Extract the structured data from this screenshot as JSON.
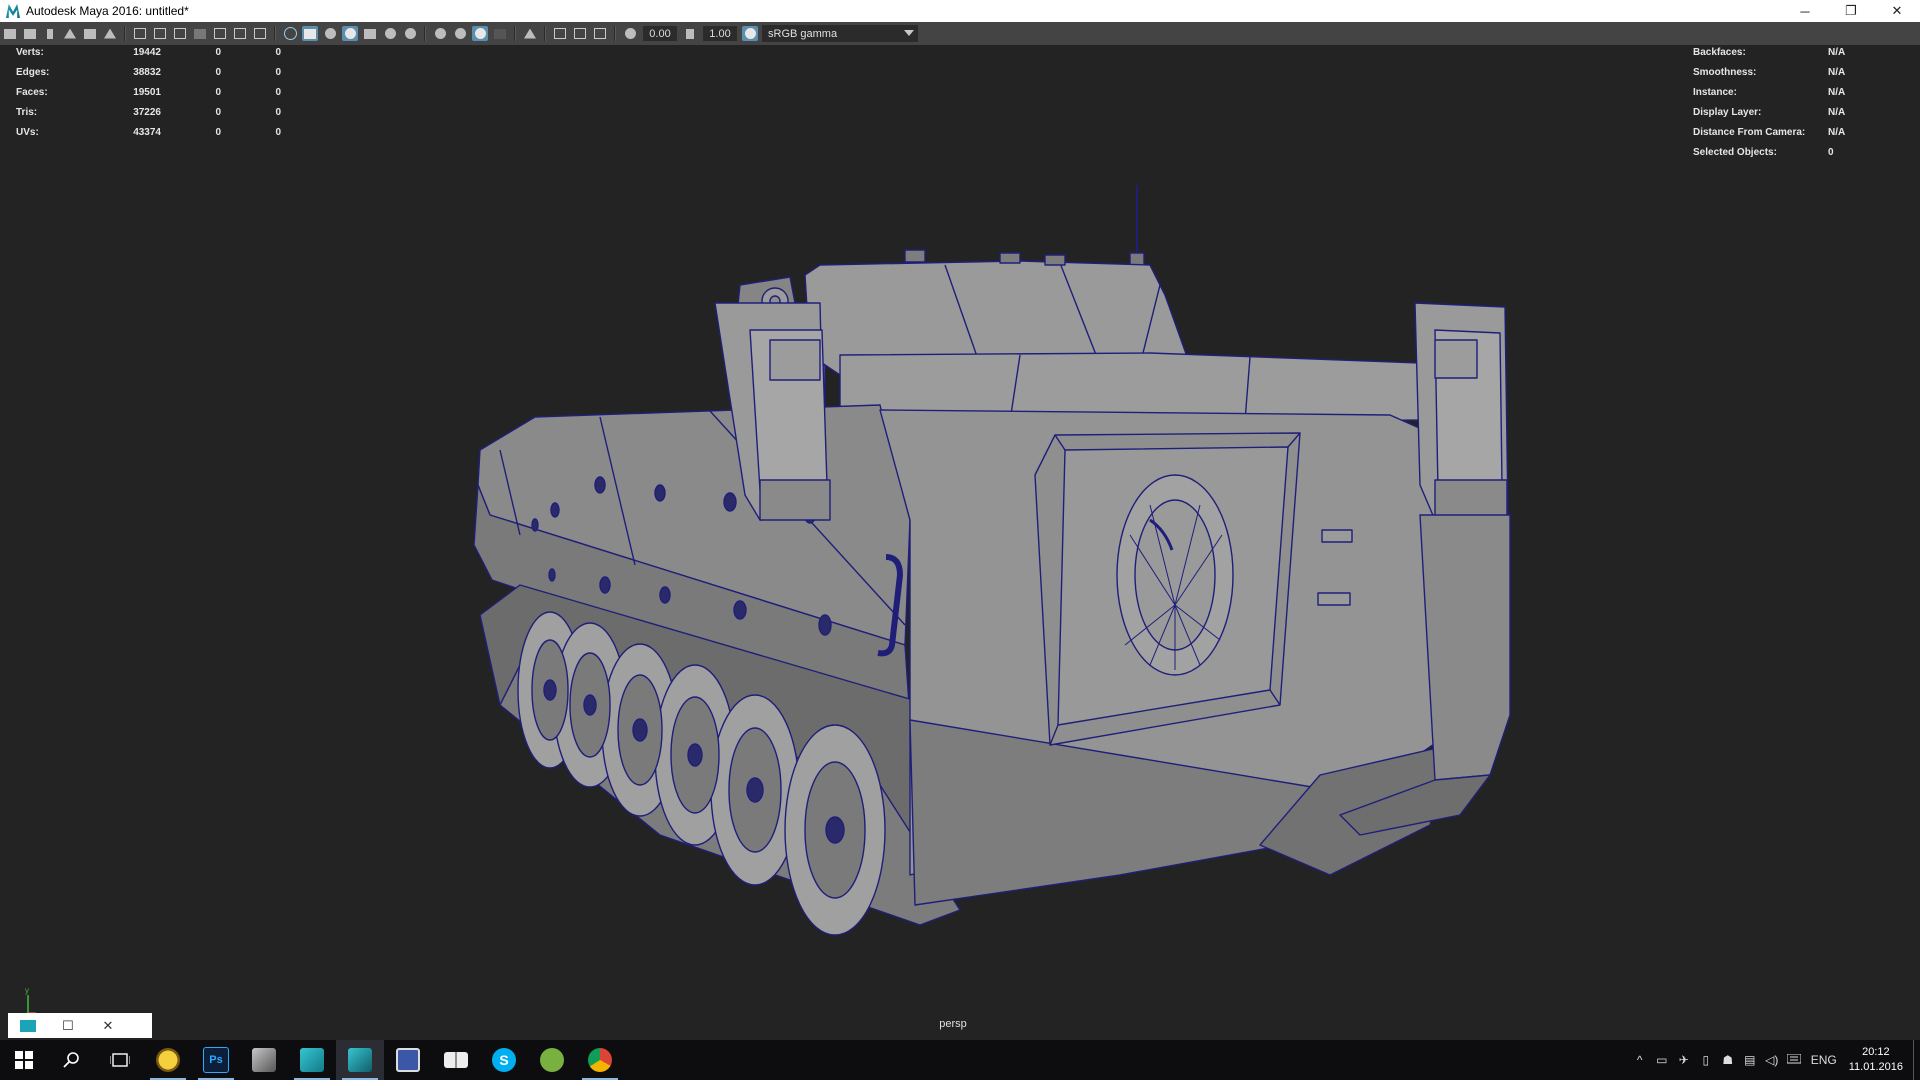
{
  "window": {
    "title": "Autodesk Maya 2016: untitled*",
    "minimize_glyph": "─",
    "restore_glyph": "❐",
    "close_glyph": "✕"
  },
  "toolbar": {
    "exposure_value": "0.00",
    "gamma_value": "1.00",
    "color_space": "sRGB gamma"
  },
  "hud_left": [
    {
      "label": "Verts:",
      "value": "19442",
      "a": "0",
      "b": "0"
    },
    {
      "label": "Edges:",
      "value": "38832",
      "a": "0",
      "b": "0"
    },
    {
      "label": "Faces:",
      "value": "19501",
      "a": "0",
      "b": "0"
    },
    {
      "label": "Tris:",
      "value": "37226",
      "a": "0",
      "b": "0"
    },
    {
      "label": "UVs:",
      "value": "43374",
      "a": "0",
      "b": "0"
    }
  ],
  "hud_right": [
    {
      "label": "Backfaces:",
      "value": "N/A"
    },
    {
      "label": "Smoothness:",
      "value": "N/A"
    },
    {
      "label": "Instance:",
      "value": "N/A"
    },
    {
      "label": "Display Layer:",
      "value": "N/A"
    },
    {
      "label": "Distance From Camera:",
      "value": "N/A"
    },
    {
      "label": "Selected Objects:",
      "value": "0"
    }
  ],
  "viewport": {
    "camera": "persp",
    "axis_label": "y",
    "mesh_fill": "#8e8e8e",
    "wire_color": "#1f1f7a"
  },
  "minimized_window": {
    "restore_glyph": "☐",
    "close_glyph": "✕"
  },
  "taskbar": {
    "apps": [
      "start-icon",
      "search-icon",
      "task-view-icon",
      "emoji-app-icon",
      "photoshop-icon",
      "zbrush-icon",
      "maya-icon",
      "maya-active-icon",
      "save-icon",
      "book-icon",
      "skype-icon",
      "utorrent-icon",
      "chrome-icon"
    ],
    "photoshop_label": "Ps",
    "skype_label": "S",
    "tray_glyphs": [
      "^",
      "▭",
      "✈",
      "▯",
      "☗",
      "▤",
      "◁)"
    ],
    "language": "ENG",
    "time": "20:12",
    "date": "11.01.2016"
  }
}
